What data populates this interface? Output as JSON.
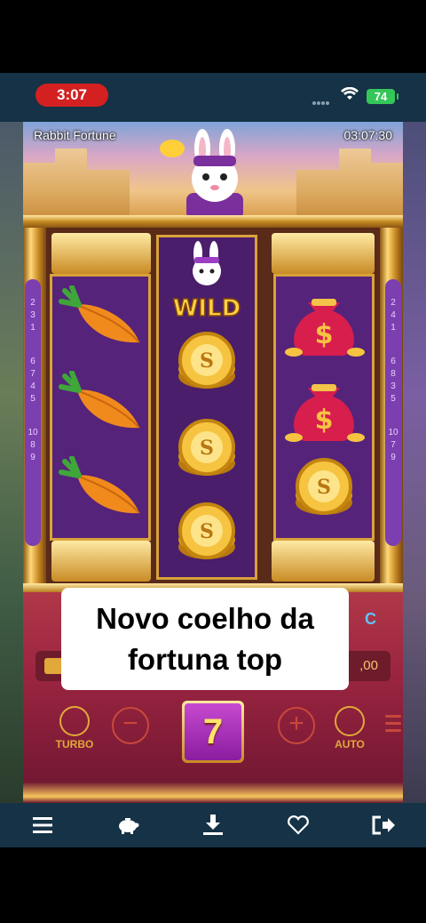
{
  "status_bar": {
    "time": "3:07",
    "battery": "74"
  },
  "game": {
    "title": "Rabbit Fortune",
    "clock": "03:07:30",
    "left_strip_numbers": [
      "2",
      "3",
      "1",
      "6",
      "7",
      "4",
      "5",
      "10",
      "8",
      "9"
    ],
    "right_strip_numbers": [
      "2",
      "4",
      "1",
      "6",
      "8",
      "3",
      "5",
      "10",
      "7",
      "9"
    ],
    "reels": [
      {
        "symbols": [
          "carrot",
          "carrot",
          "carrot"
        ]
      },
      {
        "symbols": [
          "wild",
          "gold-coin",
          "gold-coin",
          "gold-coin"
        ]
      },
      {
        "symbols": [
          "money-bag",
          "money-bag",
          "gold-coin"
        ]
      }
    ],
    "wild_label": "WILD",
    "balance_fragment": ",00",
    "c_fragment": "C",
    "turbo_label": "TURBO",
    "auto_label": "AUTO",
    "spin_symbol": "7"
  },
  "caption": {
    "text": "Novo coelho da\nfortuna top"
  },
  "nav": {
    "icons": [
      "menu-icon",
      "piggy-bank-icon",
      "download-icon",
      "heart-icon",
      "logout-icon"
    ]
  },
  "colors": {
    "bars": "#153246",
    "battery": "#35c659",
    "time_pill": "#d32020",
    "gold": "#e0a93a",
    "reel_purple": "#55237a"
  }
}
